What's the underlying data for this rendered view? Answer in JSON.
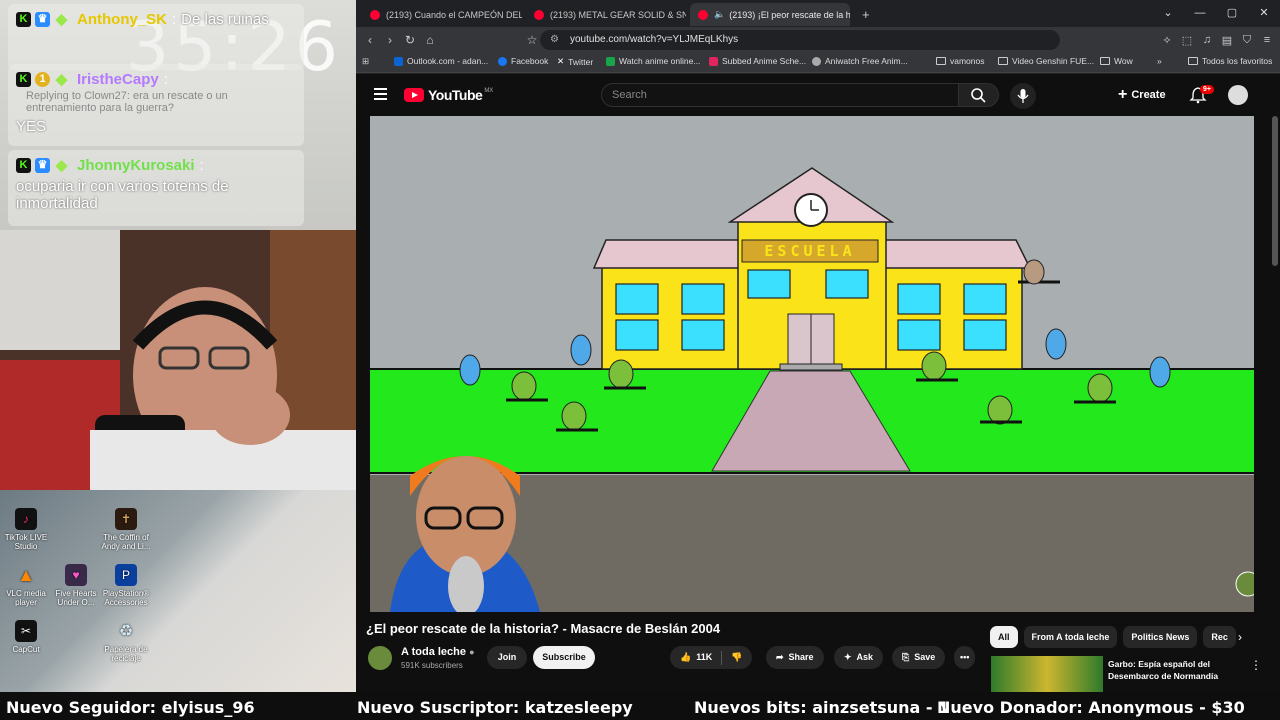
{
  "stream_overlay": {
    "clock": "35:26",
    "chat": [
      {
        "user": "Anthony_SK",
        "user_color": "#e6c800",
        "badges": [
          "kick",
          "sub",
          "gem"
        ],
        "body": "De las ruinas",
        "reply": ""
      },
      {
        "user": "IristheCapy",
        "user_color": "#b57aff",
        "badges": [
          "kick",
          "num",
          "gem"
        ],
        "badge_num": "1",
        "body": "YES",
        "reply": "Replying to Clown27: era un rescate o un entrenamiento para la guerra?"
      },
      {
        "user": "JhonnyKurosaki",
        "user_color": "#72e04a",
        "badges": [
          "kick",
          "sub",
          "gem"
        ],
        "body": "ocuparia ir con varios totems de inmortalidad",
        "reply": ""
      }
    ],
    "desktop_icons": [
      {
        "label": "TikTok LIVE Studio"
      },
      {
        "label": "The Coffin of Andy and Li..."
      },
      {
        "label": "VLC media player"
      },
      {
        "label": "Five Hearts Under O..."
      },
      {
        "label": "PlayStation® Accessories"
      },
      {
        "label": "CapCut"
      },
      {
        "label": "Papelera de reciclaje"
      }
    ]
  },
  "browser": {
    "tabs": [
      {
        "title": "(2193) Cuando el CAMPEÓN DEL MU"
      },
      {
        "title": "(2193) METAL GEAR SOLID & SNAKE"
      },
      {
        "title": "(2193) ¡El peor rescate de la h",
        "active": true
      }
    ],
    "new_tab": "+",
    "url": "youtube.com/watch?v=YLJMEqLKhys",
    "bookmarks": [
      {
        "label": "Outlook.com - adan...",
        "color": "#0a64d2"
      },
      {
        "label": "Facebook",
        "color": "#1877f2"
      },
      {
        "label": "Twitter",
        "color": "#000000"
      },
      {
        "label": "Watch anime online...",
        "color": "#19a34a"
      },
      {
        "label": "Subbed Anime Sche...",
        "color": "#e0245e"
      },
      {
        "label": "Aniwatch Free Anim...",
        "color": "#aaaaaa"
      },
      {
        "label": "vamonos",
        "folder": true
      },
      {
        "label": "Video Genshin FUE...",
        "folder": true
      },
      {
        "label": "Wow",
        "folder": true
      }
    ],
    "bookmarks_more": "»",
    "all_bookmarks": "Todos los favoritos"
  },
  "youtube": {
    "logo": "YouTube",
    "country": "MX",
    "search_placeholder": "Search",
    "create": "Create",
    "notifications": "9+",
    "video_title": "¿El peor rescate de la historia? - Masacre de Beslán 2004",
    "channel": "A toda leche",
    "subscribers": "591K subscribers",
    "join": "Join",
    "subscribe": "Subscribe",
    "likes": "11K",
    "share": "Share",
    "ask": "Ask",
    "save": "Save",
    "chips": [
      "All",
      "From A toda leche",
      "Politics News",
      "Rec"
    ],
    "recommendation": {
      "title": "Garbo: Espía español del Desembarco de Normandía"
    },
    "scene_sign": "ESCUELA"
  },
  "ticker": [
    "Nuevo Seguidor: elyisus_96",
    "Nuevo Suscriptor: katzesleepy",
    "Nuevos bits: ainzsetsuna - 1",
    "Nuevo Donador: Anonymous - $30"
  ]
}
